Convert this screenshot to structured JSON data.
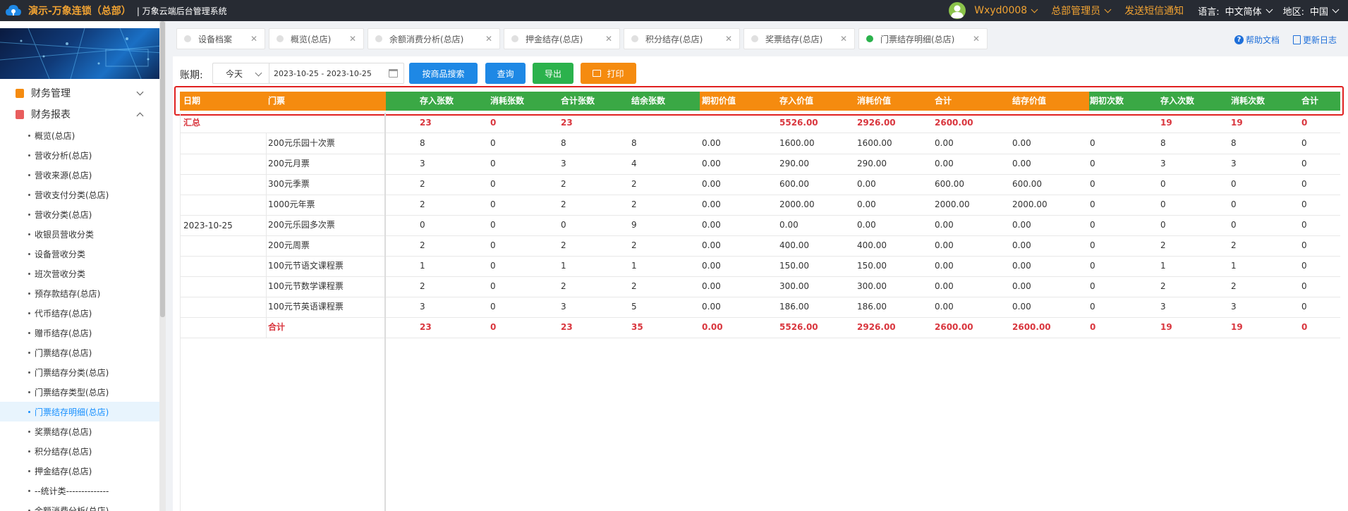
{
  "topbar": {
    "brand": "演示-万象连锁（总部）",
    "system_title": "| 万象云端后台管理系统",
    "user": "Wxyd0008",
    "role": "总部管理员",
    "sms": "发送短信通知",
    "language_label": "语言:",
    "language_value": "中文简体",
    "region_label": "地区:",
    "region_value": "中国"
  },
  "sidebar": {
    "groups": [
      {
        "label": "财务管理",
        "icon_color": "#f58b0f"
      },
      {
        "label": "财务报表",
        "icon_color": "#e85d5d"
      }
    ],
    "items": [
      "概览(总店)",
      "营收分析(总店)",
      "营收来源(总店)",
      "营收支付分类(总店)",
      "营收分类(总店)",
      "收银员营收分类",
      "设备营收分类",
      "班次营收分类",
      "预存款结存(总店)",
      "代币结存(总店)",
      "赠币结存(总店)",
      "门票结存(总店)",
      "门票结存分类(总店)",
      "门票结存类型(总店)",
      "门票结存明细(总店)",
      "奖票结存(总店)",
      "积分结存(总店)",
      "押金结存(总店)",
      "--统计类--------------",
      "余额消费分析(总店)"
    ],
    "active_index": 14
  },
  "tabs": [
    {
      "label": "设备档案",
      "close": "✕"
    },
    {
      "label": "概览(总店)",
      "close": "✕"
    },
    {
      "label": "余额消费分析(总店)",
      "close": "✕"
    },
    {
      "label": "押金结存(总店)",
      "close": "✕"
    },
    {
      "label": "积分结存(总店)",
      "close": "✕"
    },
    {
      "label": "奖票结存(总店)",
      "close": "✕"
    },
    {
      "label": "门票结存明细(总店)",
      "close": "✕"
    }
  ],
  "help": {
    "doc": "帮助文档",
    "changelog": "更新日志"
  },
  "toolbar": {
    "period_label": "账期:",
    "period_select": "今天",
    "date_range": "2023-10-25 - 2023-10-25",
    "search_by_product": "按商品搜索",
    "query": "查询",
    "export": "导出",
    "print": "打印"
  },
  "colors": {
    "orange": "#f58b0f",
    "green": "#3aa845",
    "red_text": "#d9363e",
    "accent_blue": "#1e88e5"
  },
  "table": {
    "headers": [
      "日期",
      "门票",
      "存入张数",
      "消耗张数",
      "合计张数",
      "结余张数",
      "期初价值",
      "存入价值",
      "消耗价值",
      "合计",
      "结存价值",
      "期初次数",
      "存入次数",
      "消耗次数",
      "合计"
    ],
    "summary": {
      "label": "汇总",
      "values": [
        "23",
        "0",
        "23",
        "",
        "",
        "5526.00",
        "2926.00",
        "2600.00",
        "",
        "",
        "19",
        "19",
        "0"
      ]
    },
    "date": "2023-10-25",
    "rows": [
      {
        "ticket": "200元乐园十次票",
        "values": [
          "8",
          "0",
          "8",
          "8",
          "0.00",
          "1600.00",
          "1600.00",
          "0.00",
          "0.00",
          "0",
          "8",
          "8",
          "0"
        ]
      },
      {
        "ticket": "200元月票",
        "values": [
          "3",
          "0",
          "3",
          "4",
          "0.00",
          "290.00",
          "290.00",
          "0.00",
          "0.00",
          "0",
          "3",
          "3",
          "0"
        ]
      },
      {
        "ticket": "300元季票",
        "values": [
          "2",
          "0",
          "2",
          "2",
          "0.00",
          "600.00",
          "0.00",
          "600.00",
          "600.00",
          "0",
          "0",
          "0",
          "0"
        ]
      },
      {
        "ticket": "1000元年票",
        "values": [
          "2",
          "0",
          "2",
          "2",
          "0.00",
          "2000.00",
          "0.00",
          "2000.00",
          "2000.00",
          "0",
          "0",
          "0",
          "0"
        ]
      },
      {
        "ticket": "200元乐园多次票",
        "values": [
          "0",
          "0",
          "0",
          "9",
          "0.00",
          "0.00",
          "0.00",
          "0.00",
          "0.00",
          "0",
          "0",
          "0",
          "0"
        ]
      },
      {
        "ticket": "200元周票",
        "values": [
          "2",
          "0",
          "2",
          "2",
          "0.00",
          "400.00",
          "400.00",
          "0.00",
          "0.00",
          "0",
          "2",
          "2",
          "0"
        ]
      },
      {
        "ticket": "100元节语文课程票",
        "values": [
          "1",
          "0",
          "1",
          "1",
          "0.00",
          "150.00",
          "150.00",
          "0.00",
          "0.00",
          "0",
          "1",
          "1",
          "0"
        ]
      },
      {
        "ticket": "100元节数学课程票",
        "values": [
          "2",
          "0",
          "2",
          "2",
          "0.00",
          "300.00",
          "300.00",
          "0.00",
          "0.00",
          "0",
          "2",
          "2",
          "0"
        ]
      },
      {
        "ticket": "100元节英语课程票",
        "values": [
          "3",
          "0",
          "3",
          "5",
          "0.00",
          "186.00",
          "186.00",
          "0.00",
          "0.00",
          "0",
          "3",
          "3",
          "0"
        ]
      }
    ],
    "total": {
      "label": "合计",
      "values": [
        "23",
        "0",
        "23",
        "35",
        "0.00",
        "5526.00",
        "2926.00",
        "2600.00",
        "2600.00",
        "0",
        "19",
        "19",
        "0"
      ]
    }
  }
}
